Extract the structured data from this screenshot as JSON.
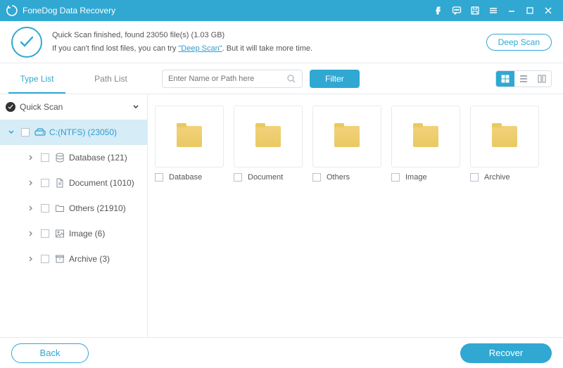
{
  "window": {
    "title": "FoneDog Data Recovery"
  },
  "status": {
    "line1_prefix": "Quick Scan finished, found ",
    "file_count": "23050",
    "line1_mid": " file(s) (",
    "size": "1.03 GB",
    "line1_suffix": ")",
    "line2_prefix": "If you can't find lost files, you can try ",
    "deep_link": "\"Deep Scan\"",
    "line2_suffix": ". But it will take more time.",
    "deep_scan_btn": "Deep Scan"
  },
  "controls": {
    "tabs": {
      "type_list": "Type List",
      "path_list": "Path List"
    },
    "search_placeholder": "Enter Name or Path here",
    "filter": "Filter"
  },
  "tree": {
    "root": "Quick Scan",
    "drive": "C:(NTFS) (23050)",
    "items": [
      {
        "label": "Database (121)",
        "icon": "db"
      },
      {
        "label": "Document (1010)",
        "icon": "doc"
      },
      {
        "label": "Others (21910)",
        "icon": "folder"
      },
      {
        "label": "Image (6)",
        "icon": "image"
      },
      {
        "label": "Archive (3)",
        "icon": "archive"
      }
    ]
  },
  "folders": [
    {
      "label": "Database"
    },
    {
      "label": "Document"
    },
    {
      "label": "Others"
    },
    {
      "label": "Image"
    },
    {
      "label": "Archive"
    }
  ],
  "footer": {
    "back": "Back",
    "recover": "Recover"
  }
}
